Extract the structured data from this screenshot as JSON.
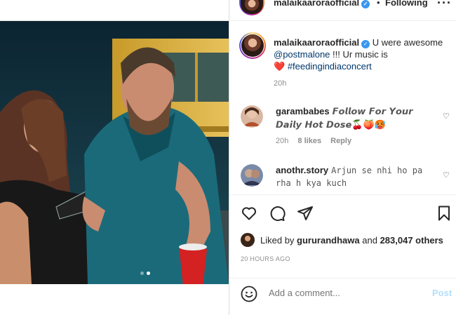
{
  "header": {
    "username": "malaikaaroraofficial",
    "verified_mark": "✓",
    "separator": "•",
    "follow_status": "Following",
    "more": "···"
  },
  "post": {
    "carousel": {
      "index": 2,
      "count": 2
    },
    "caption": {
      "username": "malaikaaroraofficial",
      "verified_mark": "✓",
      "text_before": "U were awesome",
      "mention": "@postmalone",
      "text_after": "!!! Ur music is",
      "heart": "❤️",
      "hashtag": "#feedingindiaconcert",
      "time": "20h"
    }
  },
  "comments": [
    {
      "username": "garambabes",
      "text": "𝙁𝙤𝙡𝙡𝙤𝙬 𝙁𝙤𝙧 𝙔𝙤𝙪𝙧 𝘿𝙖𝙞𝙡𝙮 𝙃𝙤𝙩 𝘿𝙤𝙨𝙚",
      "emojis": "🍒🍑🥵",
      "time": "20h",
      "likes": "8 likes",
      "reply": "Reply",
      "heart": "♡"
    },
    {
      "username": "anothr.story",
      "text": "Arjun se nhi ho pa rha h kya kuch",
      "heart": "♡"
    }
  ],
  "likes": {
    "prefix": "Liked by",
    "user": "gururandhawa",
    "middle": "and",
    "others": "283,047 others"
  },
  "posted_ago": "20 HOURS AGO",
  "add_comment": {
    "placeholder": "Add a comment...",
    "post_label": "Post"
  },
  "colors": {
    "verified": "#3897f0",
    "link": "#00376b",
    "post_disabled": "#b2dffc",
    "heart": "#ed4956"
  }
}
